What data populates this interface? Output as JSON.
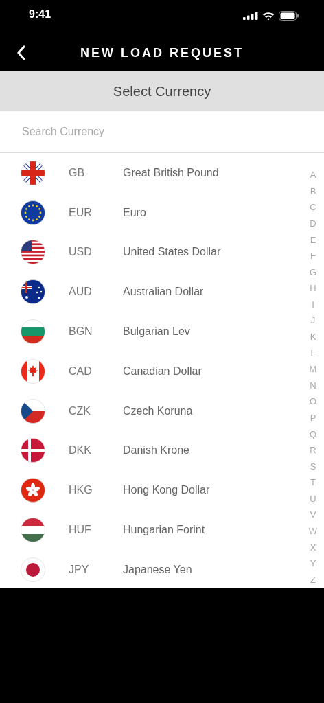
{
  "status_bar": {
    "time": "9:41"
  },
  "header": {
    "title": "NEW LOAD REQUEST"
  },
  "section": {
    "title": "Select Currency"
  },
  "search": {
    "placeholder": "Search Currency"
  },
  "currencies": [
    {
      "kind": "gb",
      "code": "GB",
      "name": "Great British Pound"
    },
    {
      "kind": "eu",
      "code": "EUR",
      "name": "Euro"
    },
    {
      "kind": "us",
      "code": "USD",
      "name": "United States Dollar"
    },
    {
      "kind": "au",
      "code": "AUD",
      "name": "Australian Dollar"
    },
    {
      "kind": "bg",
      "code": "BGN",
      "name": "Bulgarian Lev"
    },
    {
      "kind": "ca",
      "code": "CAD",
      "name": "Canadian Dollar"
    },
    {
      "kind": "cz",
      "code": "CZK",
      "name": "Czech Koruna"
    },
    {
      "kind": "dk",
      "code": "DKK",
      "name": "Danish Krone"
    },
    {
      "kind": "hk",
      "code": "HKG",
      "name": "Hong Kong Dollar"
    },
    {
      "kind": "hu",
      "code": "HUF",
      "name": "Hungarian Forint"
    },
    {
      "kind": "jp",
      "code": "JPY",
      "name": "Japanese Yen"
    }
  ],
  "index_letters": [
    "A",
    "B",
    "C",
    "D",
    "E",
    "F",
    "G",
    "H",
    "I",
    "J",
    "K",
    "L",
    "M",
    "N",
    "O",
    "P",
    "Q",
    "R",
    "S",
    "T",
    "U",
    "V",
    "W",
    "X",
    "Y",
    "Z"
  ]
}
